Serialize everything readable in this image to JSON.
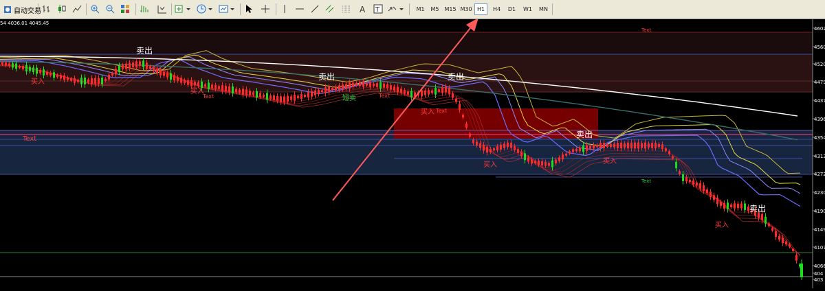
{
  "toolbar": {
    "autotrade_label": "自动交易",
    "timeframes": [
      {
        "label": "M1",
        "active": false
      },
      {
        "label": "M5",
        "active": false
      },
      {
        "label": "M15",
        "active": false
      },
      {
        "label": "M30",
        "active": false
      },
      {
        "label": "H1",
        "active": true
      },
      {
        "label": "H4",
        "active": false
      },
      {
        "label": "D1",
        "active": false
      },
      {
        "label": "W1",
        "active": false
      },
      {
        "label": "MN",
        "active": false
      }
    ]
  },
  "chart": {
    "info_text": "54 4036.01 4045.45",
    "price_labels": [
      "4602",
      "4560",
      "4520",
      "4479",
      "4437",
      "4396",
      "4354",
      "4313",
      "4272",
      "4230",
      "4190",
      "4149",
      "4107",
      "4066",
      "404",
      "403"
    ],
    "annotations": [
      {
        "id": "sell-1",
        "text": "卖出",
        "color": "#ffffff"
      },
      {
        "id": "sell-2",
        "text": "卖出",
        "color": "#ffffff"
      },
      {
        "id": "sell-3",
        "text": "卖出",
        "color": "#ffffff"
      },
      {
        "id": "sell-4",
        "text": "卖出",
        "color": "#ffffff"
      },
      {
        "id": "sell-5",
        "text": "卖出",
        "color": "#ffffff"
      },
      {
        "id": "buy-1",
        "text": "买入",
        "color": "#ff3a3a"
      },
      {
        "id": "buy-2",
        "text": "买入",
        "color": "#ff3a3a"
      },
      {
        "id": "buy-3",
        "text": "买入",
        "color": "#ff3a3a"
      },
      {
        "id": "buy-4",
        "text": "买入",
        "color": "#ff3a3a"
      },
      {
        "id": "buy-5",
        "text": "买入",
        "color": "#ff3a3a"
      },
      {
        "id": "buy-6",
        "text": "买入",
        "color": "#ff3a3a"
      },
      {
        "id": "short-sell",
        "text": "短卖",
        "color": "#2ecc40"
      },
      {
        "id": "text-left",
        "text": "Text",
        "color": "#ff3a3a"
      },
      {
        "id": "text-top",
        "text": "Text",
        "color": "#ff3a3a"
      },
      {
        "id": "text-mid1",
        "text": "Text",
        "color": "#ff3a3a"
      },
      {
        "id": "text-mid2",
        "text": "Text",
        "color": "#ff3a3a"
      },
      {
        "id": "text-mid3",
        "text": "Text",
        "color": "#ff3a3a"
      },
      {
        "id": "text-green",
        "text": "Text",
        "color": "#2ecc40"
      }
    ],
    "colors": {
      "bear": "#ff2a2a",
      "bull": "#1fdc1f",
      "ma_yellow": "#e6d84a",
      "ma_blue": "#6b6bff",
      "ma_white": "#ffffff",
      "ma_teal": "#3a6e6a",
      "zone_dark_red": "#2a1212",
      "zone_blue": "#17253f",
      "zone_red": "#8b0000",
      "arrow": "#ff5a5a"
    }
  }
}
